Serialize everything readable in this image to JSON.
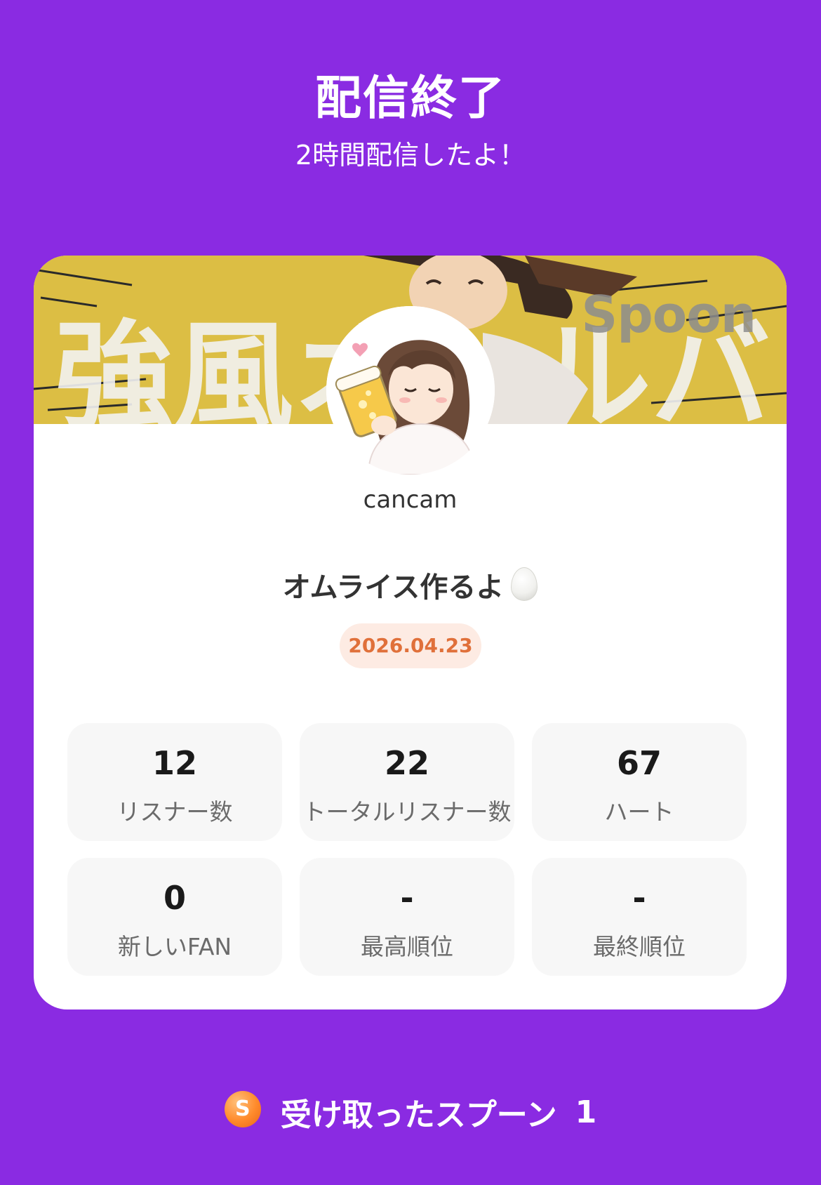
{
  "header": {
    "title": "配信終了",
    "subtitle": "2時間配信したよ！"
  },
  "card": {
    "banner_text": "強風オールバック",
    "banner_logo": "Spoon",
    "username": "cancam",
    "stream_title": "オムライス作るよ",
    "date": "2026.04.23"
  },
  "stats": [
    {
      "value": "12",
      "label": "リスナー数"
    },
    {
      "value": "22",
      "label": "トータルリスナー数"
    },
    {
      "value": "67",
      "label": "ハート"
    },
    {
      "value": "0",
      "label": "新しいFAN"
    },
    {
      "value": "-",
      "label": "最高順位"
    },
    {
      "value": "-",
      "label": "最終順位"
    }
  ],
  "spoons": {
    "icon": "spoon-coin-icon",
    "coin_letter": "S",
    "label": "受け取ったスプーン",
    "count": "1"
  },
  "colors": {
    "background": "#8a2be2",
    "banner": "#dcbe44",
    "date_text": "#e0703a",
    "date_bg": "#fdebe3"
  }
}
